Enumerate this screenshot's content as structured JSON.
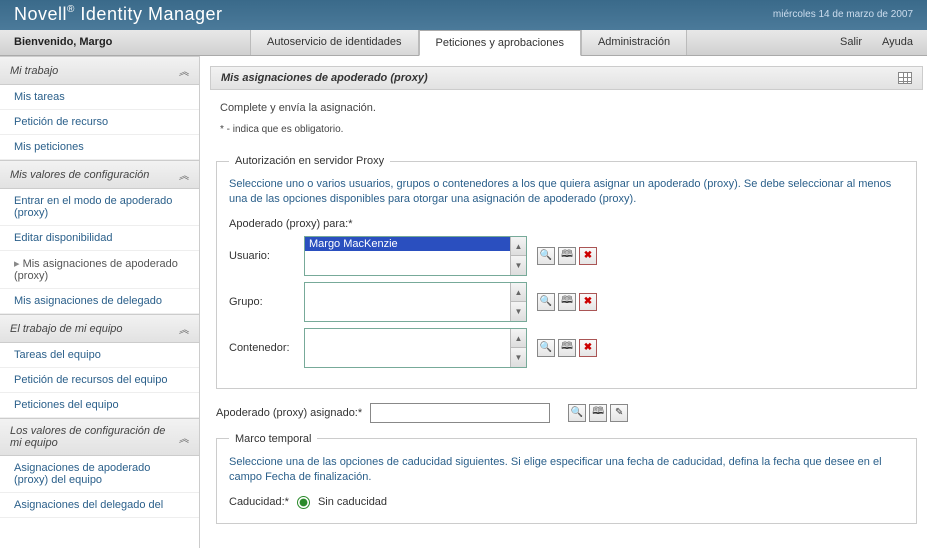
{
  "banner": {
    "product": "Novell",
    "product_suffix": "Identity Manager",
    "date": "miércoles 14 de marzo de 2007"
  },
  "topbar": {
    "welcome": "Bienvenido, Margo",
    "tabs": [
      {
        "label": "Autoservicio de identidades",
        "active": false
      },
      {
        "label": "Peticiones y aprobaciones",
        "active": true
      },
      {
        "label": "Administración",
        "active": false
      }
    ],
    "links": {
      "logout": "Salir",
      "help": "Ayuda"
    }
  },
  "sidebar": {
    "groups": [
      {
        "title": "Mi trabajo",
        "items": [
          {
            "label": "Mis tareas"
          },
          {
            "label": "Petición de recurso"
          },
          {
            "label": "Mis peticiones"
          }
        ]
      },
      {
        "title": "Mis valores de configuración",
        "items": [
          {
            "label": "Entrar en el modo de apoderado (proxy)"
          },
          {
            "label": "Editar disponibilidad"
          },
          {
            "label": "Mis asignaciones de apoderado (proxy)",
            "current": true
          },
          {
            "label": "Mis asignaciones de delegado"
          }
        ]
      },
      {
        "title": "El trabajo de mi equipo",
        "items": [
          {
            "label": "Tareas del equipo"
          },
          {
            "label": "Petición de recursos del equipo"
          },
          {
            "label": "Peticiones del equipo"
          }
        ]
      },
      {
        "title": "Los valores de configuración de mi equipo",
        "items": [
          {
            "label": "Asignaciones de apoderado (proxy) del equipo"
          },
          {
            "label": "Asignaciones del delegado del"
          }
        ]
      }
    ]
  },
  "panel": {
    "title": "Mis asignaciones de apoderado (proxy)",
    "instruction": "Complete y envía la asignación.",
    "required_note": "* - indica que es obligatorio."
  },
  "proxy_auth": {
    "legend": "Autorización en servidor Proxy",
    "help": "Seleccione uno o varios usuarios, grupos o contenedores a los que quiera asignar un apoderado (proxy). Se debe seleccionar al menos una de las opciones disponibles para otorgar una asignación de apoderado (proxy).",
    "for_label": "Apoderado (proxy) para:*",
    "rows": {
      "user": {
        "label": "Usuario:",
        "selected": "Margo MacKenzie"
      },
      "group": {
        "label": "Grupo:"
      },
      "container": {
        "label": "Contenedor:"
      }
    },
    "icons": {
      "search": "search-icon",
      "history": "history-icon",
      "remove": "remove-icon",
      "edit": "edit-icon"
    }
  },
  "assigned": {
    "label": "Apoderado (proxy) asignado:*",
    "value": ""
  },
  "timeframe": {
    "legend": "Marco temporal",
    "help": "Seleccione una de las opciones de caducidad siguientes. Si elige especificar una fecha de caducidad, defina la fecha que desee en el campo Fecha de finalización.",
    "expiry_label": "Caducidad:*",
    "option_none": "Sin caducidad"
  }
}
